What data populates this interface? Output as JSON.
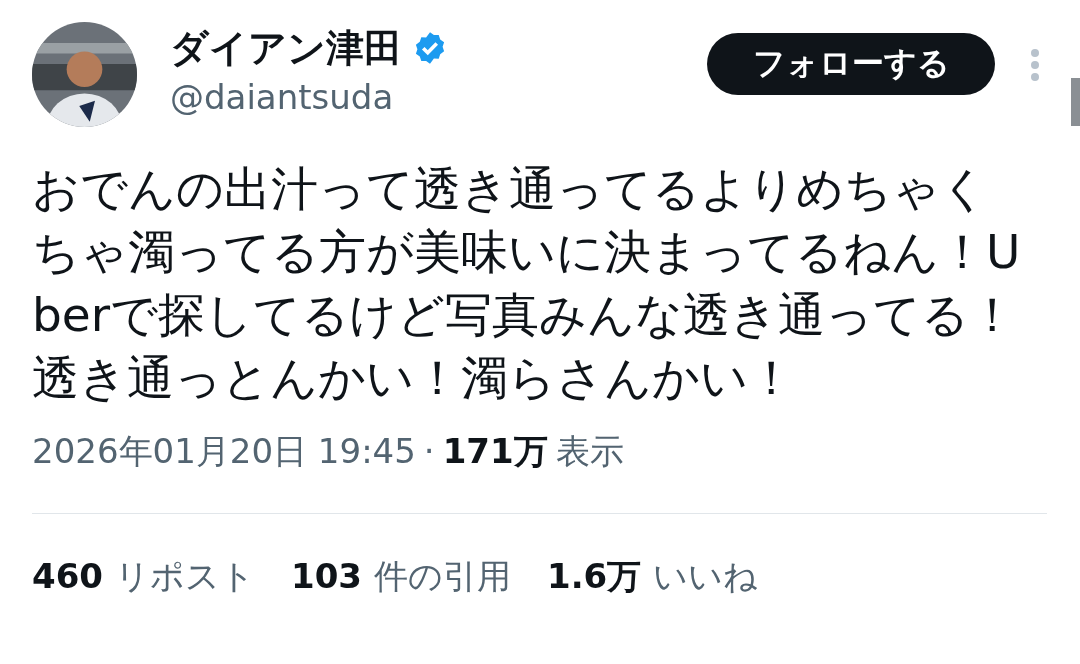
{
  "author": {
    "name": "ダイアン津田",
    "verified": true,
    "handle": "@daiantsuda"
  },
  "follow_button": "フォローする",
  "text": "おでんの出汁って透き通ってるよりめちゃくちゃ濁ってる方が美味いに決まってるねん！Uberで探してるけど写真みんな透き通ってる！透き通っとんかい！濁らさんかい！",
  "meta": {
    "timestamp": "2026年01月20日 19:45",
    "separator": "·",
    "views_count": "171万",
    "views_label": "表示"
  },
  "stats": [
    {
      "count": "460",
      "label": "リポスト"
    },
    {
      "count": "103",
      "label": "件の引用"
    },
    {
      "count": "1.6万",
      "label": "いいね"
    }
  ]
}
